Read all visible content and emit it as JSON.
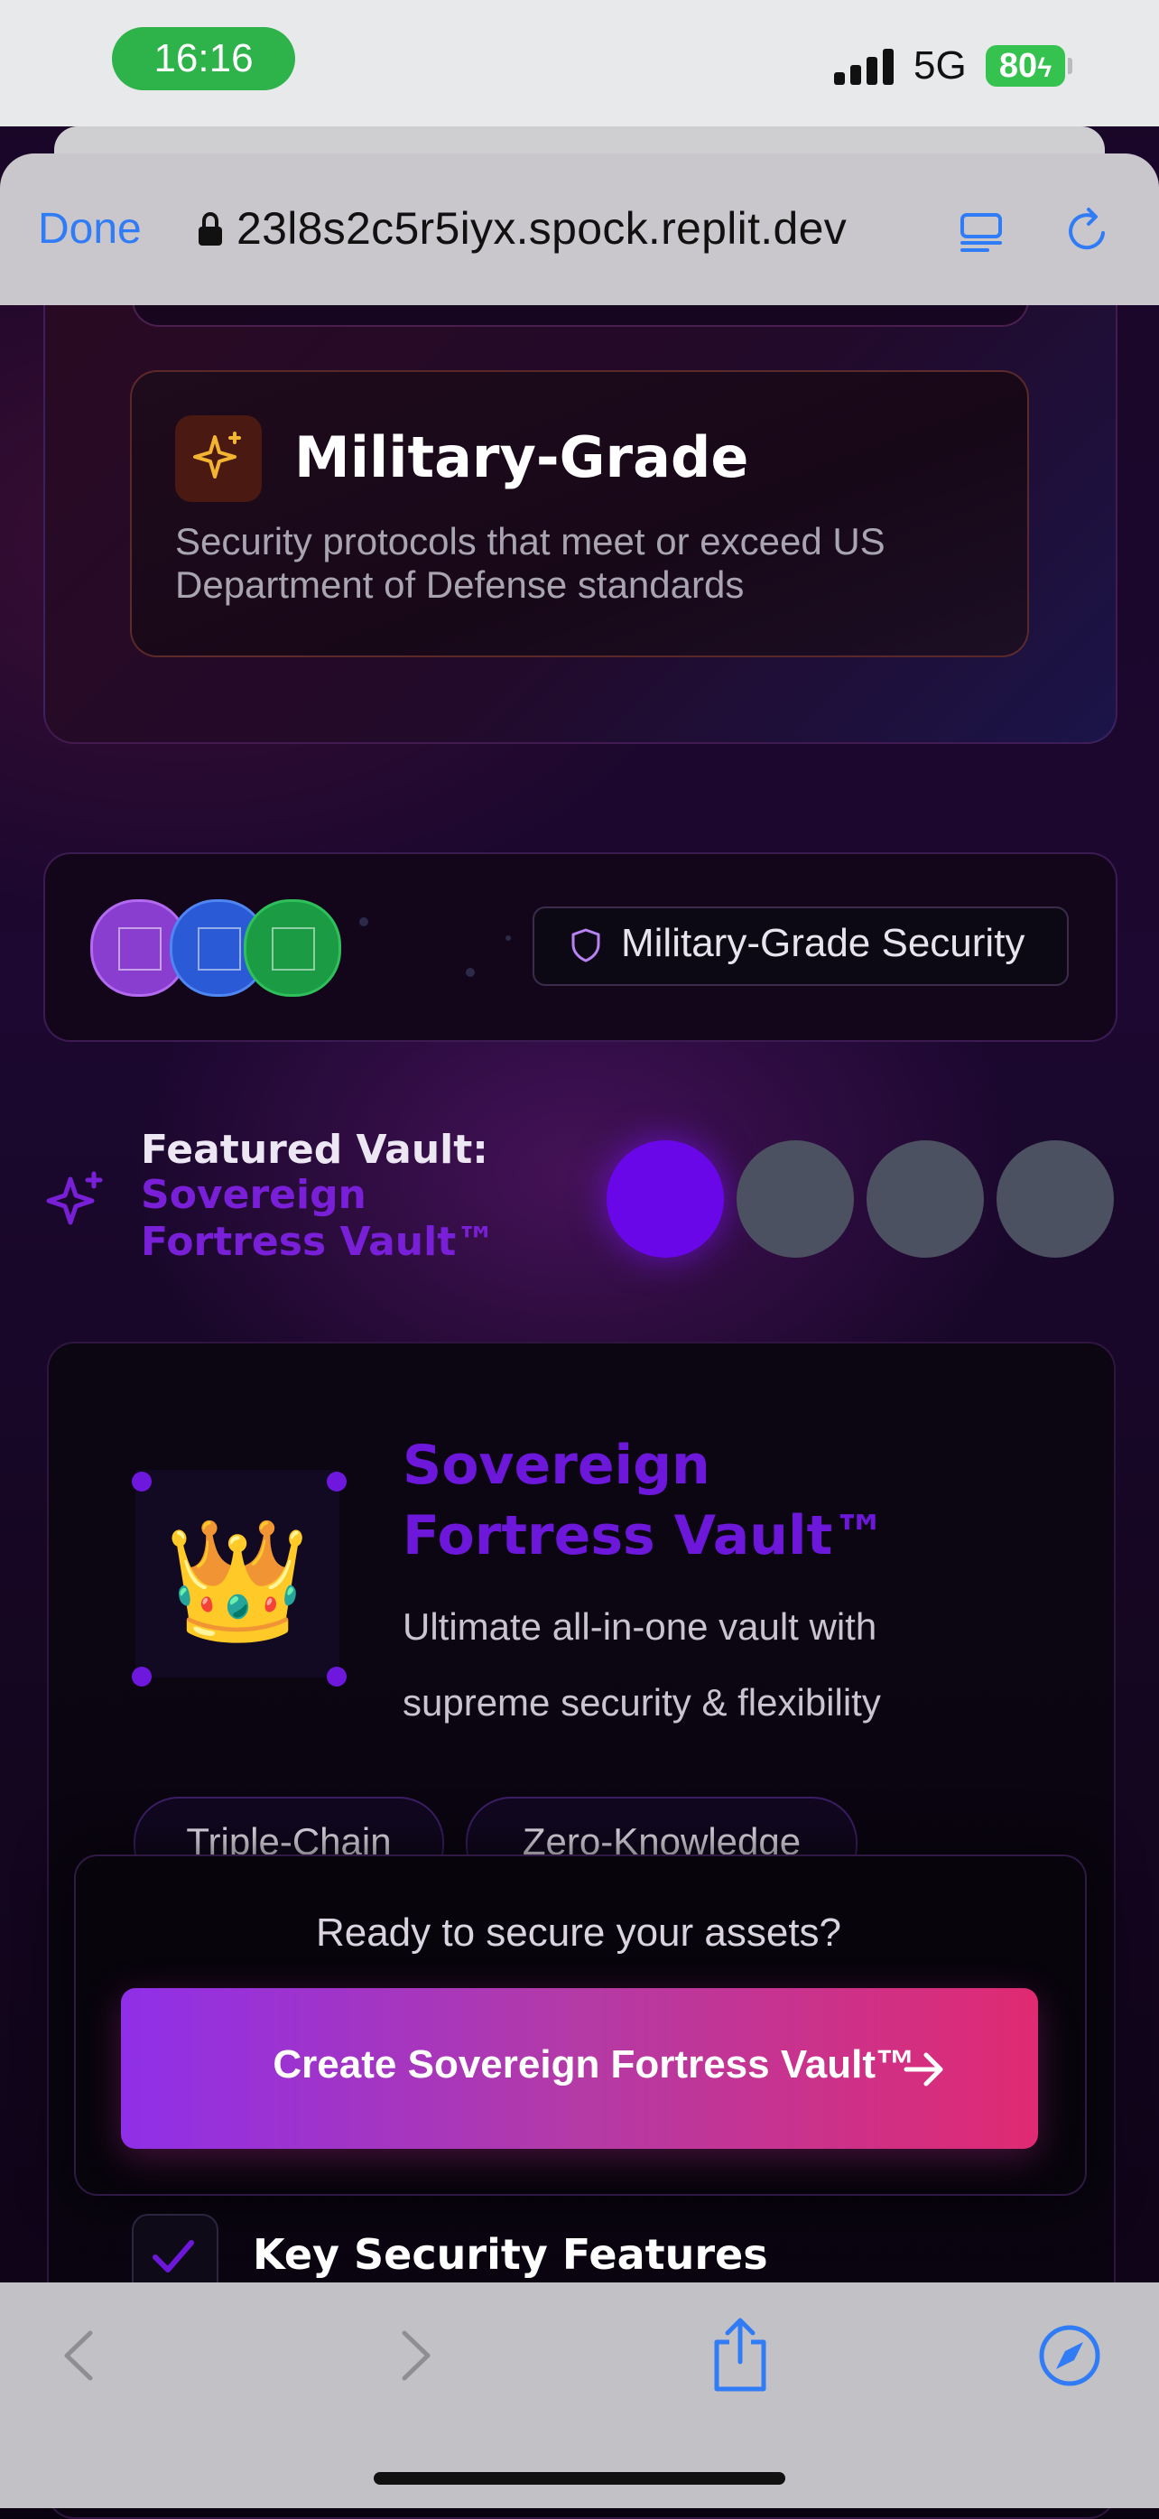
{
  "status_bar": {
    "time": "16:16",
    "network": "5G",
    "battery": "80"
  },
  "browser": {
    "done_label": "Done",
    "url": "23l8s2c5r5iyx.spock.replit.dev"
  },
  "feature_card": {
    "icon": "sparkles-icon",
    "title": "Military-Grade",
    "description": "Security protocols that meet or exceed US Department of Defense standards"
  },
  "security_strip": {
    "badge_label": "Military-Grade Security",
    "badge_icon": "shield-icon"
  },
  "featured": {
    "label": "Featured Vault:",
    "vault_name": "Sovereign Fortress Vault™",
    "pager_active_index": 0,
    "pager_count": 4
  },
  "vault": {
    "emoji": "👑",
    "title": "Sovereign Fortress Vault™",
    "description": "Ultimate all-in-one vault with supreme security & flexibility",
    "tags": [
      "Triple-Chain",
      "Zero-Knowledge"
    ]
  },
  "cta": {
    "question": "Ready to secure your assets?",
    "button_label": "Create Sovereign Fortress Vault™"
  },
  "key_features": {
    "label": "Key Security Features"
  },
  "colors": {
    "accent_purple": "#6c17d9",
    "cta_gradient_start": "#8f2fe8",
    "cta_gradient_end": "#e02a72",
    "ios_blue": "#2f7cf6",
    "time_pill_green": "#2eb24a"
  }
}
